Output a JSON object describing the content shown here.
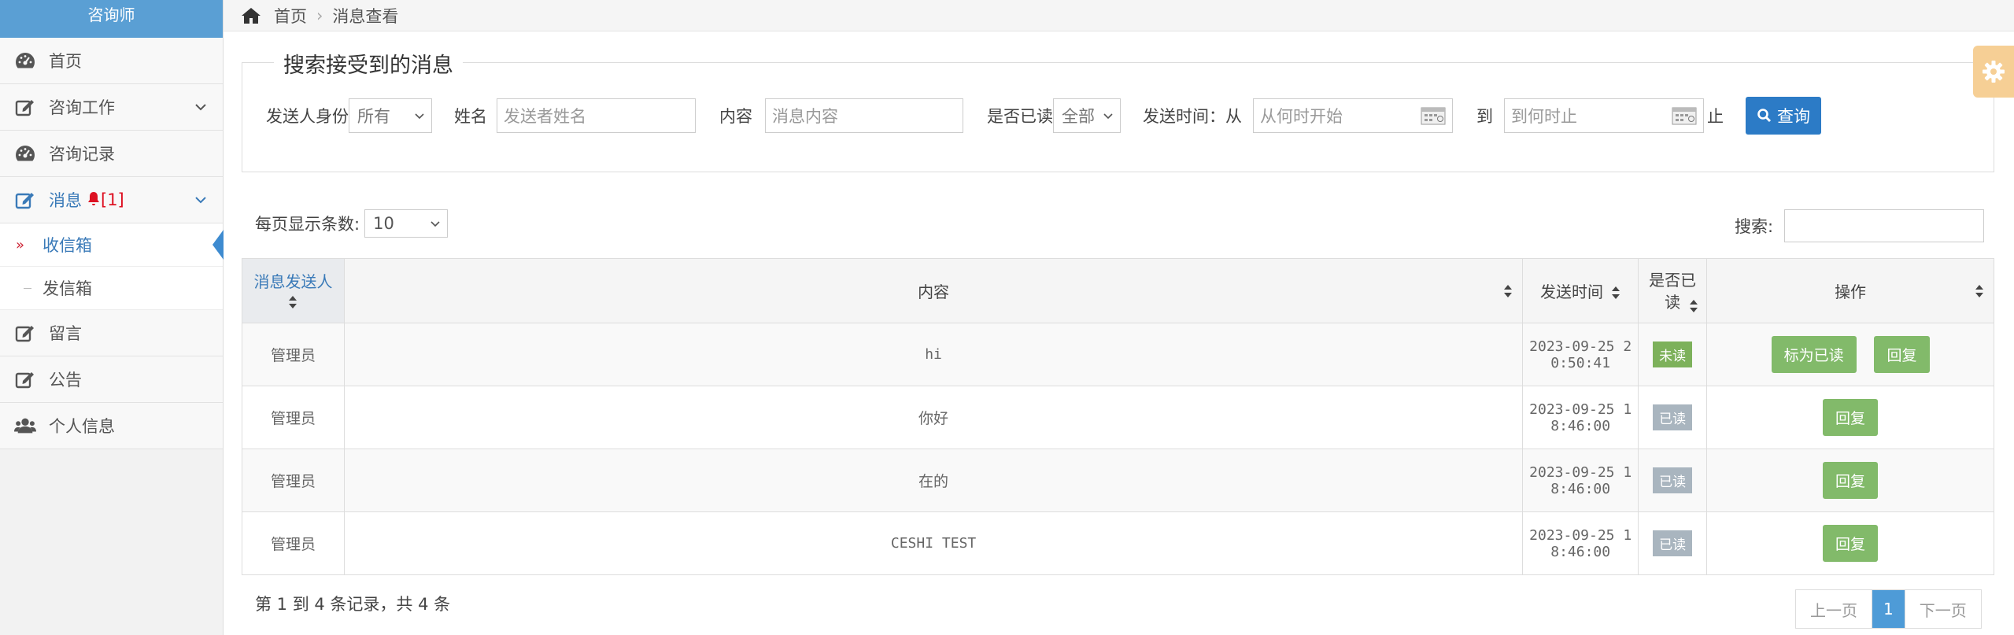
{
  "sidebar": {
    "brand": "咨询师",
    "items": [
      {
        "label": "首页"
      },
      {
        "label": "咨询工作"
      },
      {
        "label": "咨询记录"
      },
      {
        "label": "消息",
        "badge": "[1]"
      },
      {
        "label": "留言"
      },
      {
        "label": "公告"
      },
      {
        "label": "个人信息"
      }
    ],
    "sub": [
      {
        "label": "收信箱",
        "marker": "»"
      },
      {
        "label": "发信箱"
      }
    ]
  },
  "breadcrumb": {
    "home": "首页",
    "sep": "›",
    "current": "消息查看"
  },
  "filter": {
    "title": "搜索接受到的消息",
    "sender_role_label": "发送人身份",
    "sender_role_value": "所有",
    "name_label": "姓名",
    "name_placeholder": "发送者姓名",
    "content_label": "内容",
    "content_placeholder": "消息内容",
    "read_label": "是否已读",
    "read_value": "全部",
    "time_label": "发送时间：从",
    "from_placeholder": "从何时开始",
    "to_label": "到",
    "to_placeholder": "到何时止",
    "end_label": "止",
    "query_button": "查询"
  },
  "table_ctrl": {
    "length_label": "每页显示条数:",
    "length_value": "10",
    "search_label": "搜索:"
  },
  "table": {
    "headers": [
      "消息发送人",
      "内容",
      "发送时间",
      "是否已读",
      "操作"
    ],
    "rows": [
      {
        "sender": "管理员",
        "content": "hi",
        "time_a": "2023-09-25 2",
        "time_b": "0:50:41",
        "status": "未读",
        "actions": [
          "标为已读",
          "回复"
        ]
      },
      {
        "sender": "管理员",
        "content": "你好",
        "time_a": "2023-09-25 1",
        "time_b": "8:46:00",
        "status": "已读",
        "actions": [
          "回复"
        ]
      },
      {
        "sender": "管理员",
        "content": "在的",
        "time_a": "2023-09-25 1",
        "time_b": "8:46:00",
        "status": "已读",
        "actions": [
          "回复"
        ]
      },
      {
        "sender": "管理员",
        "content": "CESHI TEST",
        "time_a": "2023-09-25 1",
        "time_b": "8:46:00",
        "status": "已读",
        "actions": [
          "回复"
        ]
      }
    ]
  },
  "footer": {
    "info": "第 1 到 4 条记录，共 4 条",
    "prev": "上一页",
    "page": "1",
    "next": "下一页"
  },
  "colors": {
    "brand": "#5a9fd4",
    "primary": "#2c7bc6",
    "success": "#82ba6a",
    "unread": "#7db15b",
    "read": "#a9b5bf",
    "settings": "#f6cf95"
  }
}
